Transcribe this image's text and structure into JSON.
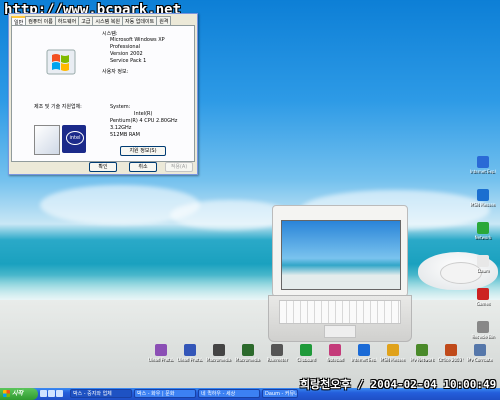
{
  "watermark": "http://www.bcpark.net",
  "dialog": {
    "tabs": [
      "일반",
      "컴퓨터 이름",
      "하드웨어",
      "고급",
      "시스템 복원",
      "자동 업데이트",
      "원격"
    ],
    "system_heading": "시스템:",
    "system_lines": [
      "Microsoft Windows XP",
      "Professional",
      "Version 2002",
      "Service Pack 1"
    ],
    "registered_heading": "사용자 정보:",
    "maker_heading": "제조 및 기술 지원업체:",
    "computer_heading": "System:",
    "computer_lines": [
      "Intel(R)",
      "Pentium(R) 4 CPU 2.80GHz",
      "3.12GHz",
      "512MB RAM"
    ],
    "support_button": "지원 정보(S)",
    "ok_button": "확인",
    "cancel_button": "취소",
    "apply_button": "적용(A)"
  },
  "desktop_icons": [
    {
      "label": "Ulead Photoimpact 10",
      "color": "#8b4fb5"
    },
    {
      "label": "Ulead Photoimpact 10",
      "color": "#3356b8"
    },
    {
      "label": "Macromedia Fireworks",
      "color": "#444"
    },
    {
      "label": "Macromedia Dreamweaver",
      "color": "#2c6a2c"
    },
    {
      "label": "Rainmeter",
      "color": "#555"
    },
    {
      "label": "Clipboard",
      "color": "#1f9a3a"
    },
    {
      "label": "Notepad",
      "color": "#c43b7a"
    },
    {
      "label": "Internet Explorer",
      "color": "#1a6ad6"
    },
    {
      "label": "MSN Messenger",
      "color": "#e0a21b"
    },
    {
      "label": "My Network",
      "color": "#4a8a2a"
    },
    {
      "label": "Office 2003 Update",
      "color": "#c04a1a"
    },
    {
      "label": "My Computer",
      "color": "#5577aa"
    }
  ],
  "right_icons": [
    {
      "label": "Internet Explorer",
      "color": "#2a6ad6"
    },
    {
      "label": "MSN Messenger",
      "color": "#1b6fd0"
    },
    {
      "label": "Network",
      "color": "#2aa83a"
    },
    {
      "label": "Daum",
      "color": "#e8e8e8"
    },
    {
      "label": "Games",
      "color": "#cc2222"
    },
    {
      "label": "Recycle Bin",
      "color": "#888"
    }
  ],
  "taskbar": {
    "start_label": "시작",
    "tasks": [
      "박스 - 중지와 업체",
      "박스 - 화우 | 문화",
      "네 퀵하우 - 세상",
      "Daum - 커뮤니티"
    ]
  },
  "clock": "희랑천오후 / 2004-02-04 10:00:49"
}
